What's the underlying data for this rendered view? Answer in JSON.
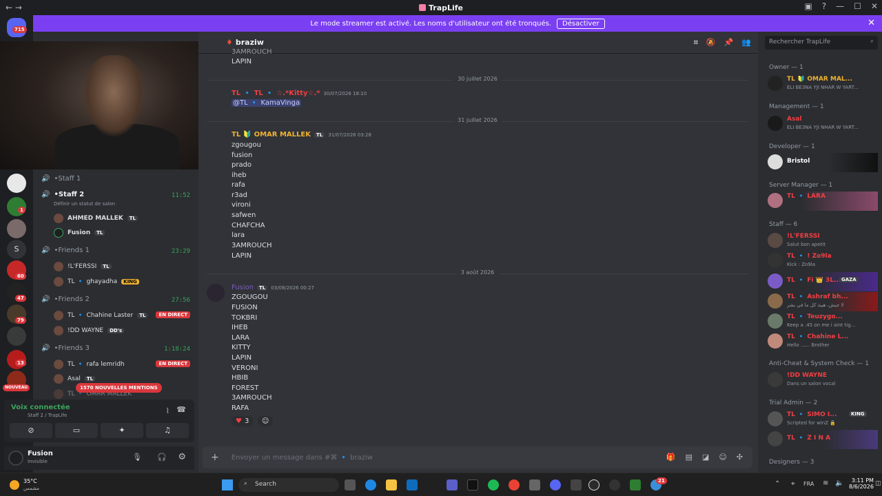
{
  "window": {
    "title": "TrapLife",
    "back": "←",
    "forward": "→"
  },
  "banner": {
    "text": "Le mode streamer est activé. Les noms d'utilisateur ont été tronqués.",
    "button": "Désactiver"
  },
  "guilds": {
    "home_badge": "715",
    "badges": [
      "1",
      "60",
      "47",
      "79",
      "13"
    ],
    "new_label": "NOUVEAU"
  },
  "channels": {
    "staff1": "Staff 1",
    "staff2": "Staff 2",
    "staff2_time": "11:52",
    "staff2_status": "Définir un statut de salon",
    "staff2_users": [
      "AHMED MALLEK",
      "Fusion"
    ],
    "friends1": "Friends 1",
    "friends1_time": "23:29",
    "friends1_users": [
      "!L'FERSSI",
      "TL 🔹 ghayadha"
    ],
    "friends2": "Friends 2",
    "friends2_time": "27:56",
    "friends2_users": [
      "TL 🔹 Chahine Laster",
      "!DD WAYNE"
    ],
    "friends3": "Friends 3",
    "friends3_time": "1:18:24",
    "friends3_users": [
      "TL 🔹 rafa lemridh",
      "Asal",
      "TL 🔹 OMAR MALLEK"
    ],
    "live_label": "EN DIRECT",
    "mentions": "1570 NOUVELLES MENTIONS",
    "tags": {
      "tl": "TL",
      "king": "KING",
      "dds": "DD's"
    }
  },
  "voice": {
    "connected": "Voix connectée",
    "location": "Staff 2 / TrapLife"
  },
  "user": {
    "name": "Fusion",
    "status": "Invisible"
  },
  "chat": {
    "channel_name": "braziw",
    "top_lines": [
      "3AMROUCH",
      "LAPIN"
    ],
    "divider1": "30 juillet 2026",
    "msg1_author": "TL 🔹 TL 🔹 ☆.*Kitty☆.*",
    "msg1_time": "30/07/2026 18:10",
    "msg1_mention": "@TL 🔹 KamaVinga",
    "divider2": "31 juillet 2026",
    "msg2_author": "TL 🔰 OMAR MALLEK",
    "msg2_time": "31/07/2026 03:28",
    "msg2_lines": [
      "zgougou",
      "fusion",
      "prado",
      "iheb",
      "rafa",
      "r3ad",
      "vironi",
      "safwen",
      "CHAFCHA",
      "lara",
      "3AMROUCH",
      "LAPIN"
    ],
    "divider3": "3 août 2026",
    "msg3_author": "Fusion",
    "msg3_time": "03/08/2026 00:27",
    "msg3_lines": [
      "ZGOUGOU",
      "FUSION",
      "TOKBRI",
      "IHEB",
      "LARA",
      "KITTY",
      "LAPIN",
      "VERONI",
      "HBIB",
      "FOREST",
      "3AMROUCH",
      "RAFA"
    ],
    "reaction_count": "3",
    "composer_placeholder": "Envoyer un message dans #⌘ 🔹 braziw"
  },
  "members": {
    "search_placeholder": "Rechercher TrapLife",
    "groups": [
      {
        "title": "Owner — 1",
        "members": [
          {
            "name": "TL 🔰 OMAR MAL...",
            "status": "ELI BE3NA YJI NHAR W YART...",
            "color": "#f0b232"
          }
        ]
      },
      {
        "title": "Management — 1",
        "members": [
          {
            "name": "Asal",
            "status": "ELI BE3NA YJI NHAR W YART...",
            "color": "#f23f43"
          }
        ]
      },
      {
        "title": "Developer — 1",
        "members": [
          {
            "name": "Bristol",
            "status": "",
            "color": "#ffffff"
          }
        ]
      },
      {
        "title": "Server Manager — 1",
        "members": [
          {
            "name": "TL 🔹 LARA",
            "status": "",
            "color": "#f23f43"
          }
        ]
      },
      {
        "title": "Staff — 6",
        "members": [
          {
            "name": "!L'FERSSI",
            "status": "Salut bon apetit",
            "color": "#f23f43"
          },
          {
            "name": "TL 🔹 ! Zo9la",
            "status": "Kick : Zo9la",
            "color": "#f23f43"
          },
          {
            "name": "TL 🔹 Fi 👑 3L...",
            "status": "",
            "color": "#f23f43"
          },
          {
            "name": "TL 🔹 Ashraf bh...",
            "status": "لا جيش، هيبة كل ما في بشر",
            "color": "#f23f43"
          },
          {
            "name": "TL 🔹 Teuzygo...",
            "status": "Keep a .45 on me i aint tig...",
            "color": "#f23f43"
          },
          {
            "name": "TL 🔹 Chahine L...",
            "status": "Hello ...... Brother",
            "color": "#f23f43"
          }
        ]
      },
      {
        "title": "Anti-Cheat & System Check — 1",
        "members": [
          {
            "name": "!DD WAYNE",
            "status": "Dans un salon vocal",
            "color": "#f23f43"
          }
        ]
      },
      {
        "title": "Trial Admin — 2",
        "members": [
          {
            "name": "TL 🔹 SIMO I...",
            "status": "Scripted for winZ 🔒",
            "color": "#f23f43"
          },
          {
            "name": "TL 🔹 Z I N A",
            "status": "",
            "color": "#f23f43"
          }
        ]
      },
      {
        "title": "Designers — 3",
        "members": []
      }
    ],
    "badges": {
      "king": "KING",
      "gaza": "GAZA",
      "tl": "TL",
      "n64": "64e",
      "one": "1",
      "dds": "DD's"
    }
  },
  "taskbar": {
    "weather_temp": "35°C",
    "weather_desc": "مشمس",
    "search": "Search",
    "lang": "FRA",
    "time": "3:11 PM",
    "date": "8/6/2026",
    "badge": "21"
  }
}
